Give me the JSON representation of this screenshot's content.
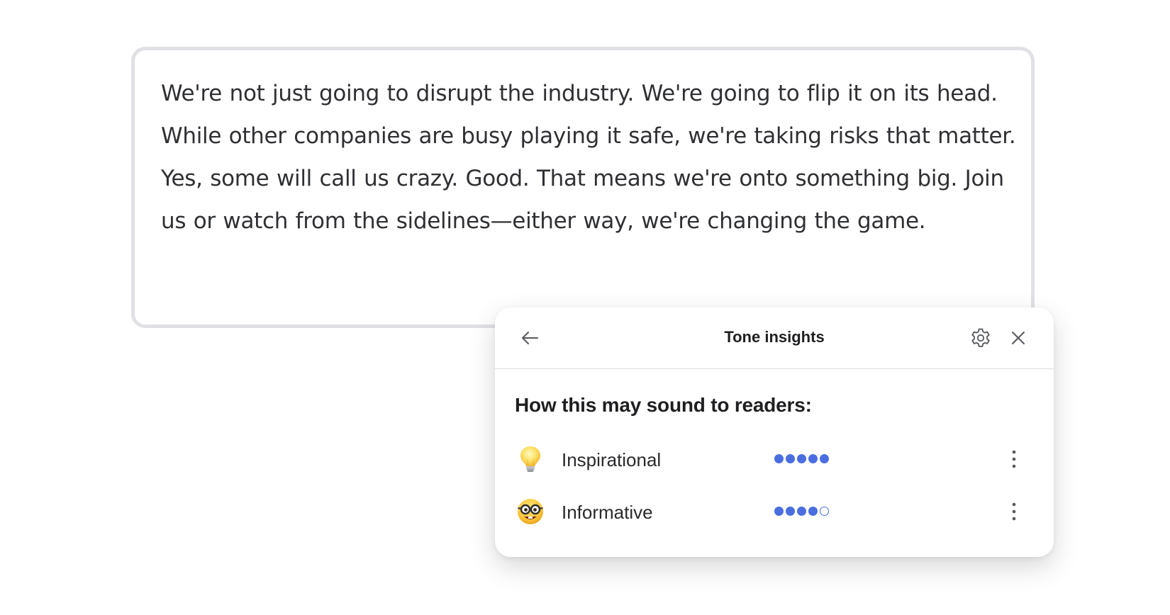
{
  "editor": {
    "text": "We're not just going to disrupt the industry. We're going to flip it on its head. While other companies are busy playing it safe, we're taking risks that matter. Yes, some will call us crazy. Good. That means we're onto something big. Join us or watch from the sidelines—either way, we're changing the game."
  },
  "panel": {
    "title": "Tone insights",
    "back_icon": "arrow-left-icon",
    "settings_icon": "gear-icon",
    "close_icon": "close-icon",
    "heading": "How this may sound to readers:",
    "tones": [
      {
        "label": "Inspirational",
        "icon": "lightbulb-emoji",
        "score": 5,
        "max": 5
      },
      {
        "label": "Informative",
        "icon": "nerd-face-emoji",
        "score": 4,
        "max": 5
      }
    ],
    "more_icon": "vertical-ellipsis-icon"
  },
  "colors": {
    "accent": "#4a6ee0",
    "text": "#2f3033",
    "border": "#e1e1e5"
  }
}
